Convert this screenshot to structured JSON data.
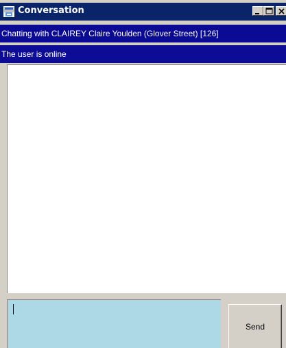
{
  "window": {
    "title": "Conversation",
    "icon": "chat-app-icon",
    "controls": [
      "minimize-icon",
      "maximize-icon",
      "close-icon"
    ]
  },
  "header": {
    "chat_with": "Chatting with CLAIREY Claire Youlden (Glover Street) [126]",
    "status": "The user is online"
  },
  "compose": {
    "value": ""
  },
  "send": {
    "label": "Send"
  },
  "colors": {
    "titlebar": "#0a246a",
    "banner": "#0a0a94",
    "compose_bg": "#add8e6",
    "face": "#d4d0c8"
  }
}
